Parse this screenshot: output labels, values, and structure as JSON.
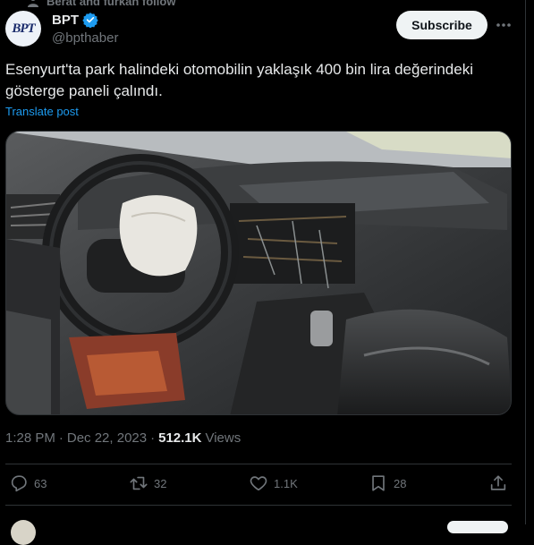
{
  "social_context": {
    "text": "Berat and furkan follow"
  },
  "author": {
    "avatar_text": "BPT",
    "display_name": "BPT",
    "handle": "@bpthaber",
    "verified": true
  },
  "subscribe_label": "Subscribe",
  "tweet": {
    "text": "Esenyurt'ta park halindeki otomobilin yaklaşık 400 bin lira değerindeki gösterge paneli çalındı.",
    "translate_label": "Translate post"
  },
  "meta": {
    "time": "1:28 PM",
    "sep1": "·",
    "date": "Dec 22, 2023",
    "sep2": "·",
    "views_count": "512.1K",
    "views_label": "Views"
  },
  "actions": {
    "replies": "63",
    "reposts": "32",
    "likes": "1.1K",
    "bookmarks": "28"
  },
  "colors": {
    "background": "#000000",
    "text": "#e7e9ea",
    "muted": "#71767b",
    "link": "#1d9bf0",
    "verified": "#1d9bf0",
    "divider": "#2f3336"
  }
}
